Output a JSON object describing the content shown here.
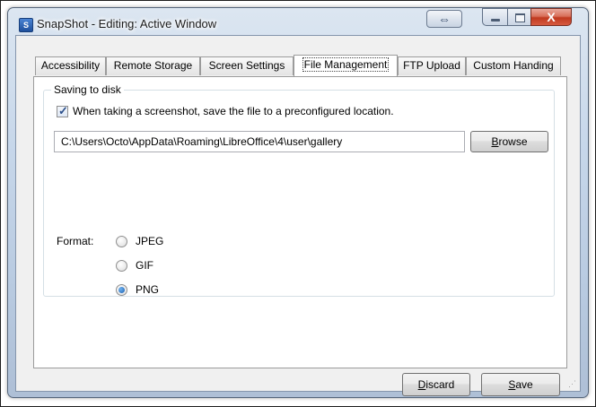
{
  "window": {
    "title": "SnapShot - Editing: Active Window",
    "app_icon_letter": "S",
    "resize_glyph": "⇔",
    "close_glyph": "X"
  },
  "tabs": [
    {
      "label": "Accessibility",
      "active": false
    },
    {
      "label": "Remote Storage",
      "active": false
    },
    {
      "label": "Screen Settings",
      "active": false
    },
    {
      "label": "File Management",
      "active": true
    },
    {
      "label": "FTP Upload",
      "active": false
    },
    {
      "label": "Custom Handing",
      "active": false
    }
  ],
  "saving": {
    "group_title": "Saving to disk",
    "checkbox_label": "When taking a screenshot, save the file to a preconfigured location.",
    "checkbox_checked": true,
    "path_value": "C:\\Users\\Octo\\AppData\\Roaming\\LibreOffice\\4\\user\\gallery",
    "browse_label_first": "B",
    "browse_label_rest": "rowse"
  },
  "format": {
    "label": "Format:",
    "options": [
      {
        "label": "JPEG",
        "checked": false
      },
      {
        "label": "GIF",
        "checked": false
      },
      {
        "label": "PNG",
        "checked": true
      }
    ]
  },
  "footer": {
    "discard_first": "D",
    "discard_rest": "iscard",
    "save_first": "S",
    "save_rest": "ave"
  },
  "icons": {
    "app": "snapshot-app-icon",
    "resize": "resize-arrows-icon",
    "minimize": "minimize-icon",
    "maximize": "maximize-icon",
    "close": "close-icon"
  },
  "colors": {
    "close_button": "#c0391f",
    "radio_selected": "#1d5fb0",
    "panel_background": "#f0f0f0"
  }
}
